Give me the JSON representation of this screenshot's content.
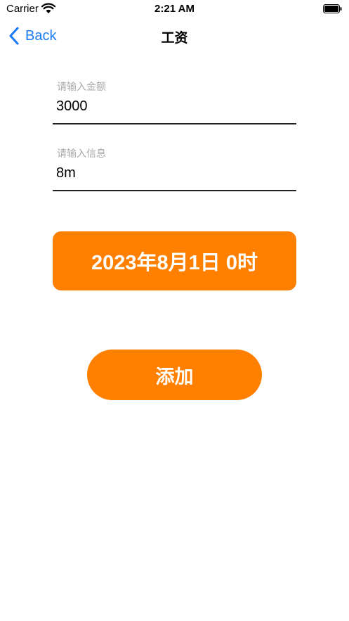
{
  "status_bar": {
    "carrier": "Carrier",
    "time": "2:21 AM",
    "wifi_icon": "wifi-icon",
    "battery_icon": "battery-icon"
  },
  "nav": {
    "back_label": "Back",
    "back_icon": "chevron-left-icon",
    "title": "工资"
  },
  "form": {
    "amount": {
      "label": "请输入金额",
      "value": "3000"
    },
    "info": {
      "label": "请输入信息",
      "value": "8m"
    }
  },
  "date_button": {
    "label": "2023年8月1日 0时"
  },
  "add_button": {
    "label": "添加"
  },
  "colors": {
    "accent": "#ff8000",
    "link": "#1a7cf5",
    "label_gray": "#a9a9a9"
  }
}
